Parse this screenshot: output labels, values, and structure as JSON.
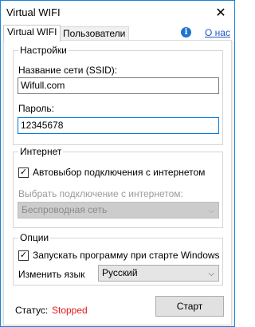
{
  "window": {
    "title": "Virtual WIFI",
    "close_glyph": "✕"
  },
  "tabs": [
    {
      "label": "Virtual WIFI",
      "active": true
    },
    {
      "label": "Пользователи",
      "active": false
    }
  ],
  "header": {
    "info_icon": "info-icon",
    "info_glyph": "i",
    "about_link": "О нас"
  },
  "settings": {
    "title": "Настройки",
    "ssid_label": "Название сети (SSID):",
    "ssid_value": "Wifull.com",
    "password_label": "Пароль:",
    "password_value": "12345678"
  },
  "internet": {
    "title": "Интернет",
    "auto_label": "Автовыбор подключения с интернетом",
    "auto_checked": true,
    "check_glyph": "✓",
    "choose_label": "Выбрать подключение с интернетом:",
    "connection_value": "Беспроводная сеть",
    "chevron_glyph": "⌵"
  },
  "options": {
    "title": "Опции",
    "startup_label": "Запускать программу при старте Windows",
    "startup_checked": true,
    "language_label": "Изменить язык",
    "language_value": "Русский"
  },
  "footer": {
    "status_label": "Статус:",
    "status_value": "Stopped",
    "status_color": "#e01b1b",
    "start_button": "Старт"
  }
}
